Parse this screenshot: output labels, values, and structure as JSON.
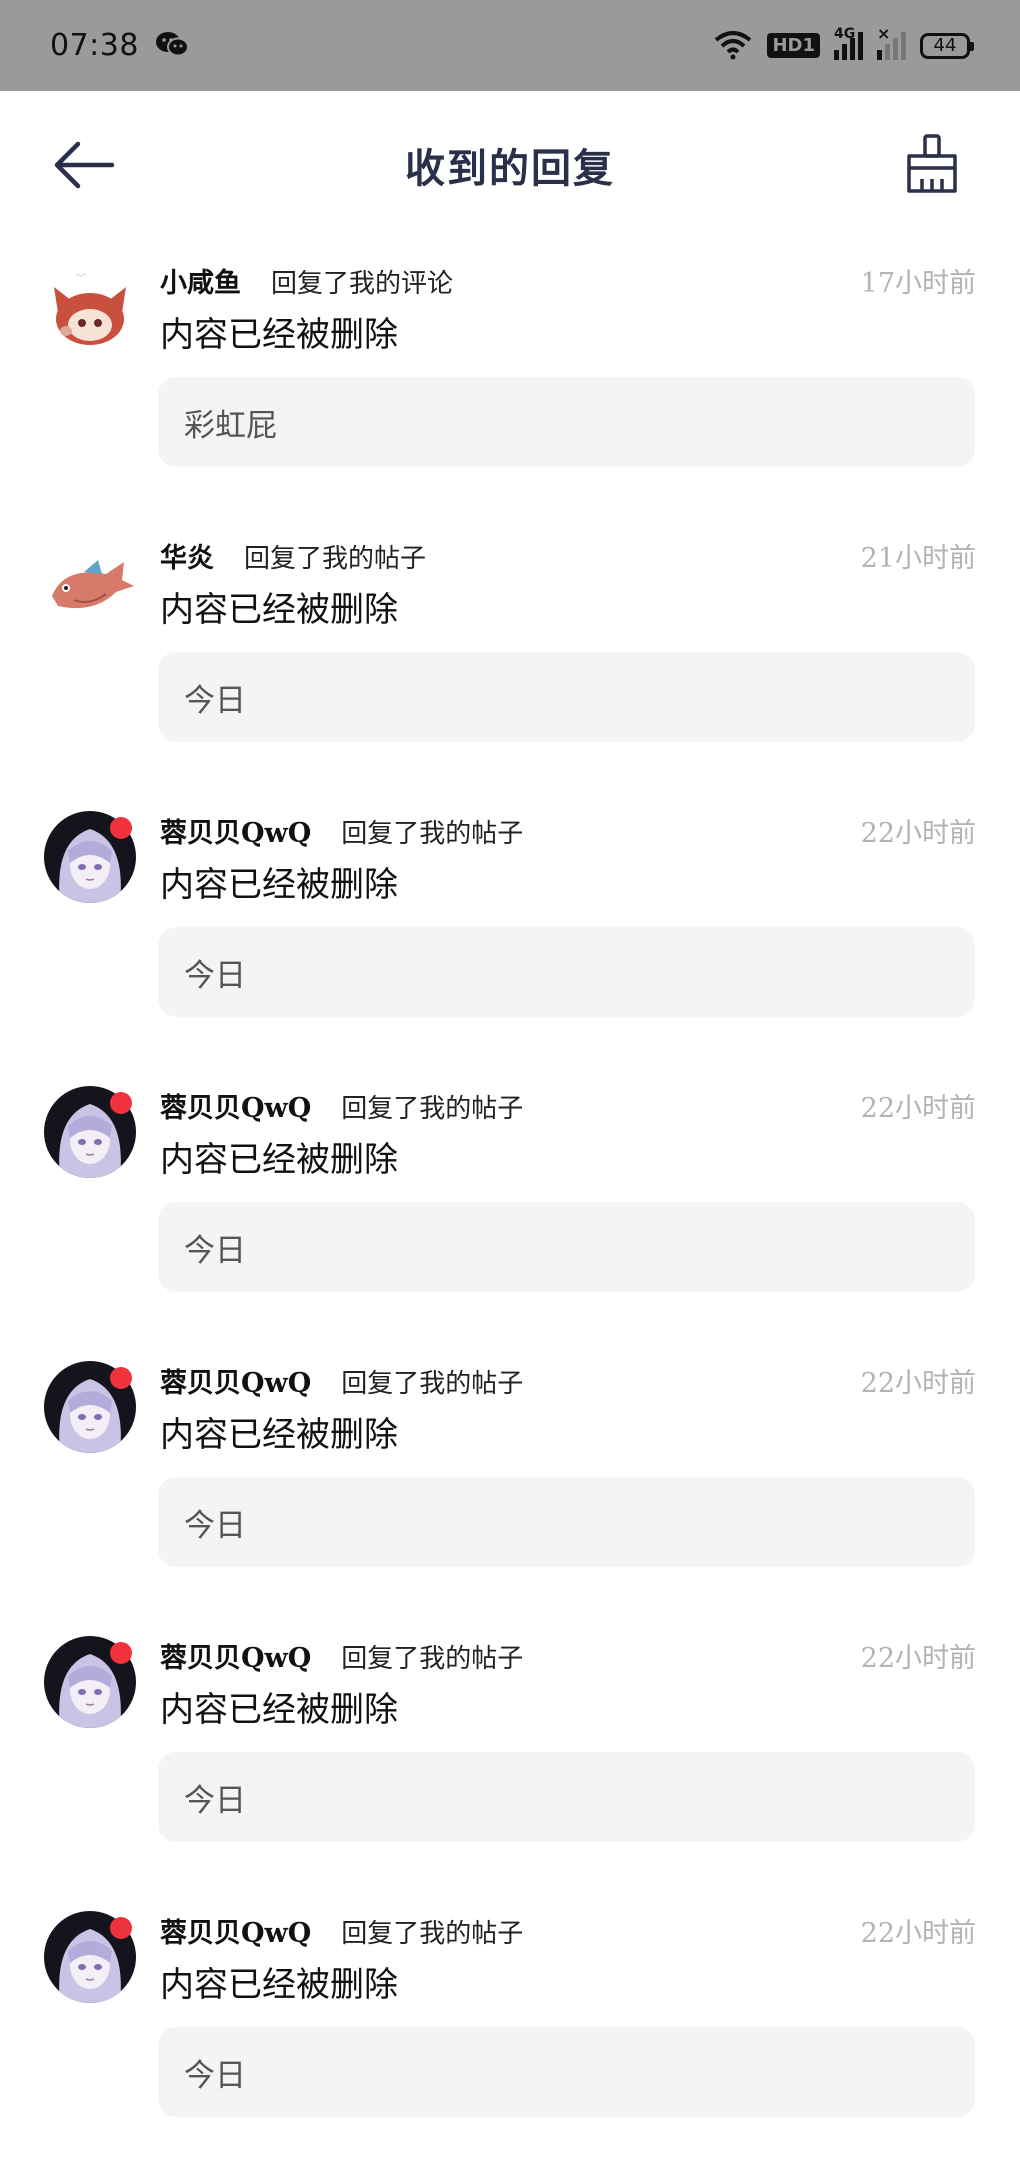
{
  "status_bar": {
    "time": "07:38",
    "network": "4G",
    "hd": "HD1",
    "battery": "44"
  },
  "header": {
    "title": "收到的回复"
  },
  "replies": [
    {
      "username": "小咸鱼",
      "action": "回复了我的评论",
      "time": "17小时前",
      "content": "内容已经被删除",
      "quote": "彩虹屁",
      "avatar": "red-hair-girl",
      "unread": false
    },
    {
      "username": "华炎",
      "action": "回复了我的帖子",
      "time": "21小时前",
      "content": "内容已经被删除",
      "quote": "今日",
      "avatar": "fish",
      "unread": false
    },
    {
      "username": "蓉贝贝QwQ",
      "action": "回复了我的帖子",
      "time": "22小时前",
      "content": "内容已经被删除",
      "quote": "今日",
      "avatar": "purple-hair-girl",
      "unread": true
    },
    {
      "username": "蓉贝贝QwQ",
      "action": "回复了我的帖子",
      "time": "22小时前",
      "content": "内容已经被删除",
      "quote": "今日",
      "avatar": "purple-hair-girl",
      "unread": true
    },
    {
      "username": "蓉贝贝QwQ",
      "action": "回复了我的帖子",
      "time": "22小时前",
      "content": "内容已经被删除",
      "quote": "今日",
      "avatar": "purple-hair-girl",
      "unread": true
    },
    {
      "username": "蓉贝贝QwQ",
      "action": "回复了我的帖子",
      "time": "22小时前",
      "content": "内容已经被删除",
      "quote": "今日",
      "avatar": "purple-hair-girl",
      "unread": true
    },
    {
      "username": "蓉贝贝QwQ",
      "action": "回复了我的帖子",
      "time": "22小时前",
      "content": "内容已经被删除",
      "quote": "今日",
      "avatar": "purple-hair-girl",
      "unread": true
    }
  ],
  "colors": {
    "status_bar_bg": "#9a9a9a",
    "title": "#2a2f4a",
    "unread_dot": "#f0323c",
    "quote_bg": "#f4f4f4",
    "time": "#b3b3b3"
  }
}
